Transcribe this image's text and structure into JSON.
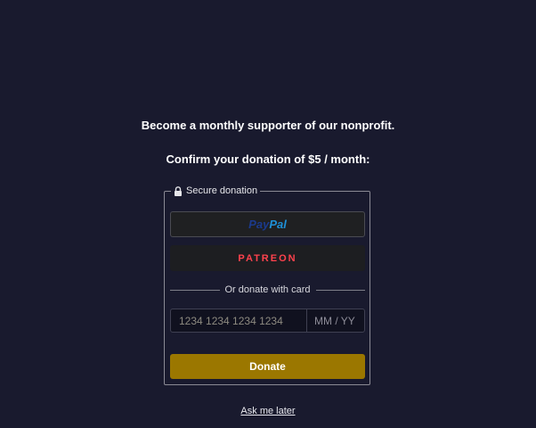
{
  "header": {
    "headline": "Become a monthly supporter of our nonprofit.",
    "confirm_text": "Confirm your donation of $5 / month:"
  },
  "secure_box": {
    "legend": "Secure donation",
    "legend_icon": "lock-icon",
    "border_color": "#8a8a94"
  },
  "payment_options": {
    "paypal": {
      "label_part1": "Pay",
      "label_part2": "Pal",
      "color_dark": "#1b3a8c",
      "color_light": "#1f8fd6"
    },
    "patreon": {
      "label": "PATREON",
      "color": "#ff424d"
    }
  },
  "card_section": {
    "divider_text": "Or donate with card",
    "card_number_placeholder": "1234 1234 1234 1234",
    "expiry_placeholder": "MM / YY"
  },
  "actions": {
    "donate_label": "Donate",
    "donate_color": "#9b7700",
    "ask_later_label": "Ask me later"
  },
  "theme": {
    "background": "#191a2e"
  }
}
